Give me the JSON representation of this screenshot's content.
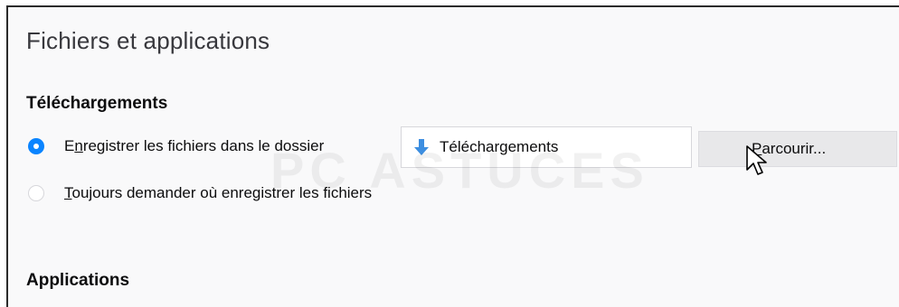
{
  "section": {
    "title": "Fichiers et applications"
  },
  "downloads": {
    "heading": "Téléchargements",
    "save_option": {
      "prefix": "E",
      "access_key": "n",
      "rest": "registrer les fichiers dans le dossier",
      "selected": true
    },
    "ask_option": {
      "access_key": "T",
      "rest": "oujours demander où enregistrer les fichiers",
      "selected": false
    },
    "folder": {
      "icon": "download-arrow-icon",
      "name": "Téléchargements"
    },
    "browse": {
      "access_key": "P",
      "rest": "arcourir..."
    }
  },
  "applications": {
    "heading": "Applications"
  },
  "watermark": {
    "text": "PC ASTUCES"
  },
  "colors": {
    "accent": "#0a84ff",
    "panel_bg": "#f9f9fa"
  }
}
